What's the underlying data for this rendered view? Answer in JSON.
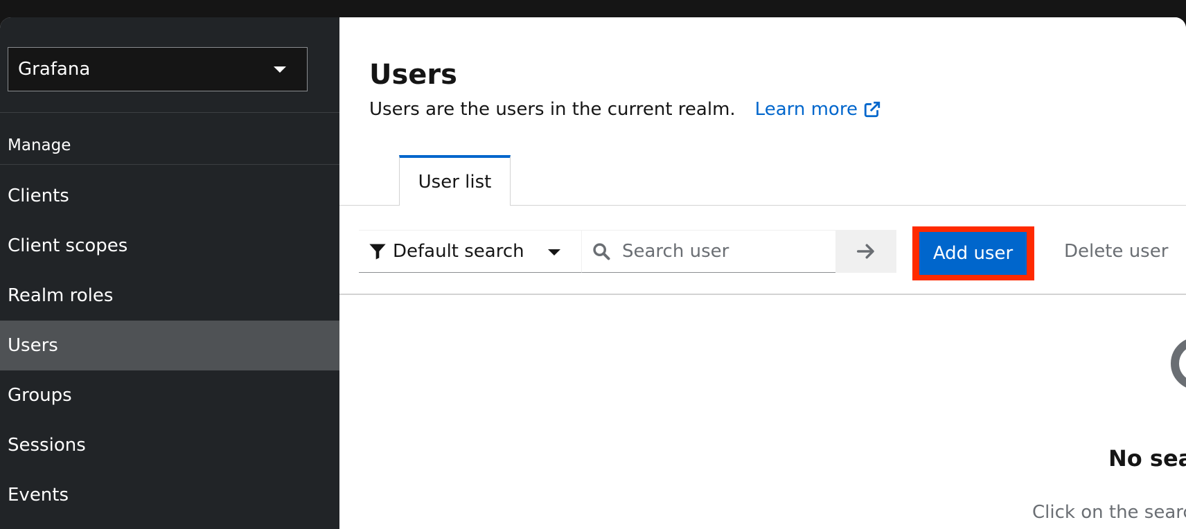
{
  "sidebar": {
    "realm": "Grafana",
    "section_label": "Manage",
    "items": [
      {
        "label": "Clients"
      },
      {
        "label": "Client scopes"
      },
      {
        "label": "Realm roles"
      },
      {
        "label": "Users",
        "active": true
      },
      {
        "label": "Groups"
      },
      {
        "label": "Sessions"
      },
      {
        "label": "Events"
      }
    ]
  },
  "main": {
    "title": "Users",
    "description": "Users are the users in the current realm.",
    "learn_more": "Learn more",
    "tabs": [
      {
        "label": "User list",
        "active": true
      }
    ],
    "toolbar": {
      "filter_label": "Default search",
      "search_placeholder": "Search user",
      "add_user_label": "Add user",
      "delete_user_label": "Delete user"
    },
    "empty_state": {
      "title": "No sea",
      "body": "Click on the searc"
    }
  },
  "colors": {
    "accent": "#0066cc",
    "highlight": "#ff2a00",
    "sidebar_bg": "#212427",
    "sidebar_active": "#4f5255"
  }
}
